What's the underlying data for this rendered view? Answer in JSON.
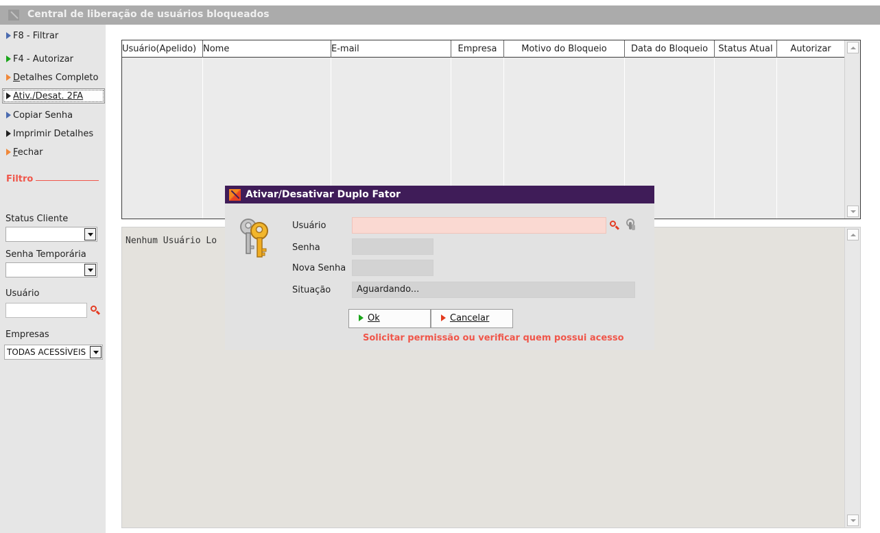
{
  "window": {
    "title": "Central de liberação de usuários bloqueados"
  },
  "sidebar": {
    "menu": [
      {
        "label": "F8 - Filtrar",
        "icon": "blue-triangle-icon"
      },
      {
        "label": "F4 - Autorizar",
        "icon": "green-triangle-icon"
      },
      {
        "label": "Detalhes Completo",
        "accel": "D",
        "icon": "orange-triangle-icon"
      },
      {
        "label": "Ativ./Desat. 2FA",
        "icon": "black-triangle-icon"
      },
      {
        "label": "Copiar Senha",
        "icon": "blue-triangle-icon"
      },
      {
        "label": "Imprimir Detalhes",
        "icon": "black-triangle-icon"
      },
      {
        "label": "Fechar",
        "accel": "F",
        "icon": "orange-triangle-icon"
      }
    ],
    "filter_title": "Filtro",
    "filters": {
      "status_cliente_label": "Status Cliente",
      "status_cliente_value": "",
      "senha_temporaria_label": "Senha Temporária",
      "senha_temporaria_value": "",
      "usuario_label": "Usuário",
      "usuario_value": "",
      "empresas_label": "Empresas",
      "empresas_value": "TODAS ACESSÍVEIS"
    }
  },
  "grid": {
    "columns": [
      "Usuário(Apelido)",
      "Nome",
      "E-mail",
      "Empresa",
      "Motivo do Bloqueio",
      "Data do Bloqueio",
      "Status Atual",
      "Autorizar"
    ],
    "rows": []
  },
  "details": {
    "message": "Nenhum Usuário Lo"
  },
  "dialog": {
    "title": "Ativar/Desativar Duplo Fator",
    "usuario_label": "Usuário",
    "usuario_value": "",
    "senha_label": "Senha",
    "senha_value": "",
    "nova_senha_label": "Nova Senha",
    "nova_senha_value": "",
    "situacao_label": "Situação",
    "situacao_value": "Aguardando...",
    "ok_label": "Ok",
    "cancel_label": "Cancelar",
    "warning": "Solicitar permissão ou verificar quem possui acesso"
  },
  "colors": {
    "dialog_title_bg": "#3f1c58",
    "accent_red": "#f0564a",
    "pink_field": "#fad9d2",
    "sidebar_bg": "#e6e6e6"
  }
}
